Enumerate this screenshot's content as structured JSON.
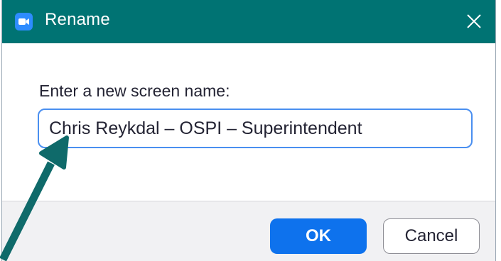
{
  "window": {
    "title": "Rename",
    "app_icon": "zoom-camera-icon",
    "close_icon": "close-icon"
  },
  "dialog": {
    "prompt": "Enter a new screen name:",
    "input_value": "Chris Reykdal – OSPI – Superintendent"
  },
  "buttons": {
    "ok_label": "OK",
    "cancel_label": "Cancel"
  },
  "annotation": {
    "arrow_icon": "annotation-arrow-icon"
  },
  "colors": {
    "titlebar": "#007373",
    "accent": "#0e72ed",
    "input_border": "#4a8ff0",
    "arrow": "#0f6a6a",
    "footer": "#f1f1f3"
  }
}
